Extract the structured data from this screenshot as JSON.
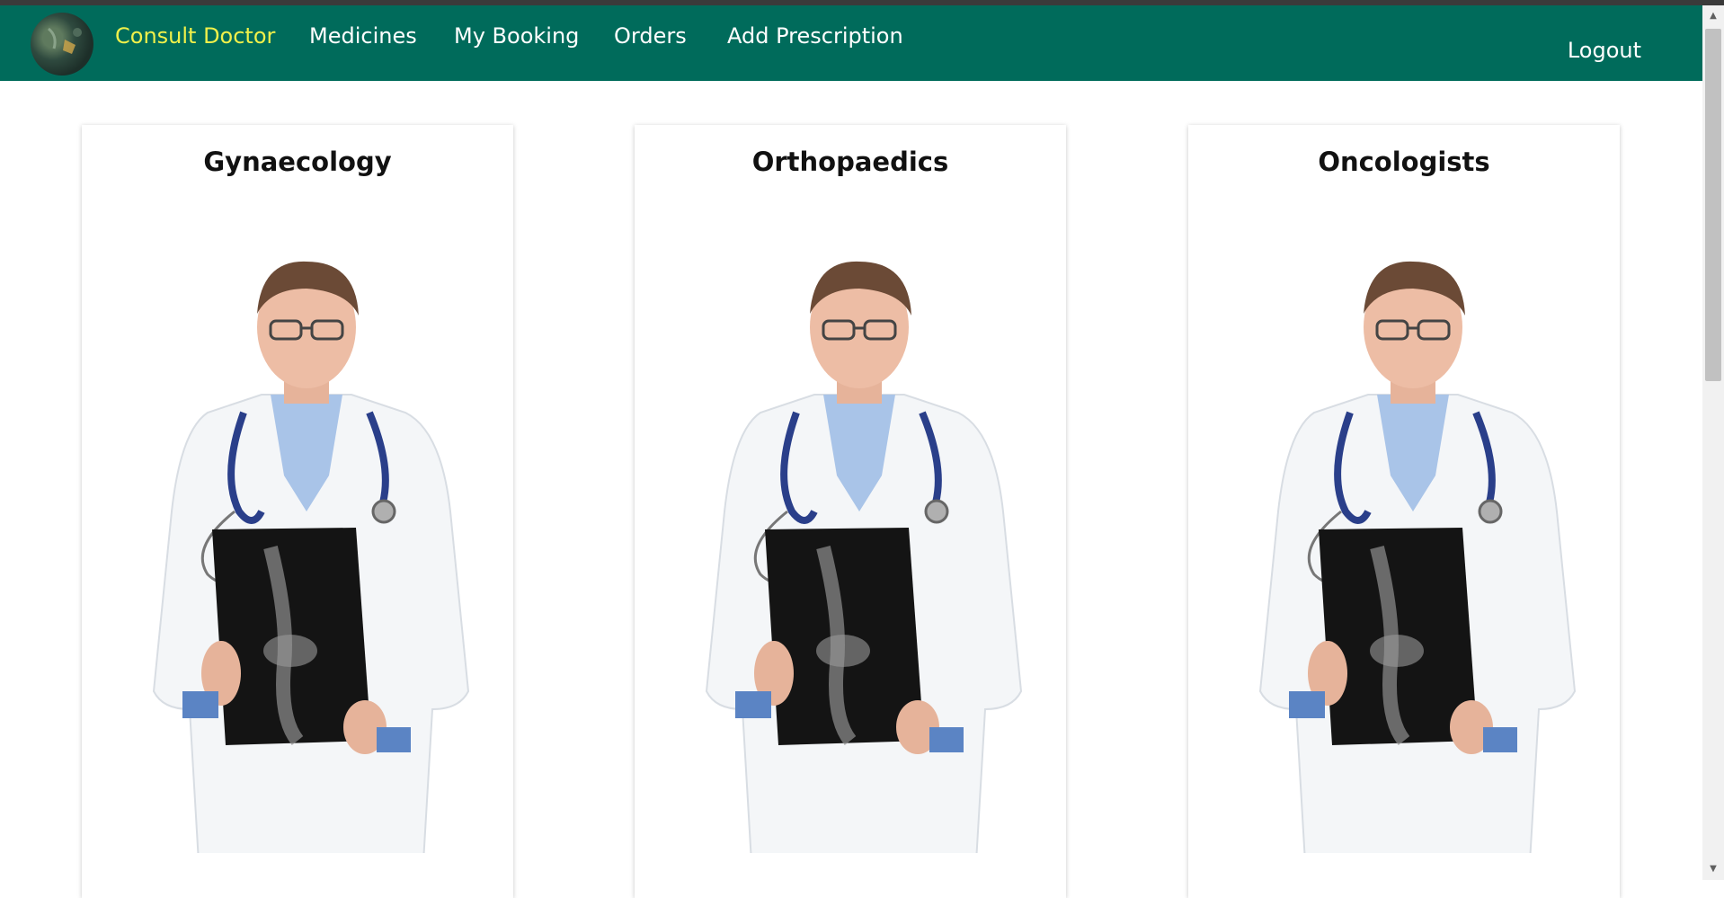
{
  "navbar": {
    "logo_icon": "clinic-logo",
    "active_color": "#f0f04a",
    "background": "#006b5b",
    "links": [
      {
        "label": "Consult Doctor",
        "active": true
      },
      {
        "label": "Medicines",
        "active": false
      },
      {
        "label": "My Booking",
        "active": false
      },
      {
        "label": "Orders",
        "active": false
      },
      {
        "label": "Add Prescription",
        "active": false
      }
    ],
    "logout_label": "Logout"
  },
  "specialties": [
    {
      "title": "Gynaecology",
      "image": "doctor-with-xray-photo"
    },
    {
      "title": "Orthopaedics",
      "image": "doctor-with-xray-photo"
    },
    {
      "title": "Oncologists",
      "image": "doctor-with-xray-photo"
    }
  ]
}
